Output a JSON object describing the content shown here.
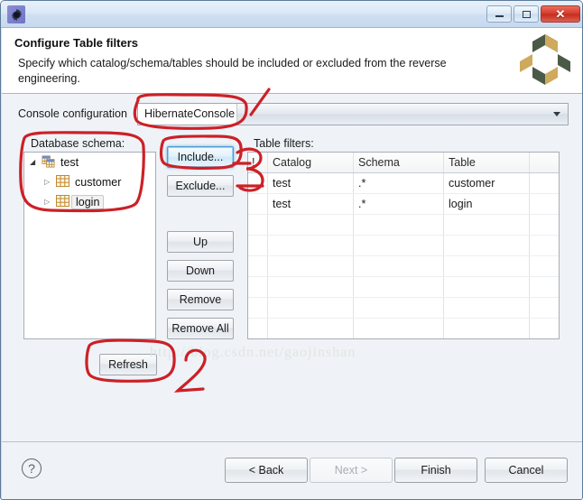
{
  "window": {
    "app_icon": "gear-icon",
    "minimize_label": "Minimize",
    "maximize_label": "Maximize",
    "close_label": "Close"
  },
  "header": {
    "title": "Configure Table filters",
    "description": "Specify which catalog/schema/tables should be included or excluded from the reverse engineering.",
    "logo": "hibernate-logo"
  },
  "console": {
    "label": "Console configuration",
    "value": "HibernateConsole",
    "dropdown_icon": "chevron-down-icon"
  },
  "schema": {
    "label": "Database schema:",
    "tree": [
      {
        "label": "test",
        "level": 0,
        "icon": "database-schema-icon",
        "expanded": true,
        "twisty": "◢",
        "selected": false
      },
      {
        "label": "customer",
        "level": 1,
        "icon": "table-icon",
        "expanded": false,
        "twisty": "▷",
        "selected": false
      },
      {
        "label": "login",
        "level": 1,
        "icon": "table-icon",
        "expanded": false,
        "twisty": "▷",
        "selected": true
      }
    ]
  },
  "actions": {
    "include": "Include...",
    "exclude": "Exclude...",
    "up": "Up",
    "down": "Down",
    "remove": "Remove",
    "remove_all": "Remove All",
    "refresh": "Refresh"
  },
  "filters": {
    "label": "Table filters:",
    "columns": [
      "!",
      "Catalog",
      "Schema",
      "Table",
      ""
    ],
    "rows": [
      [
        "",
        "test",
        ".*",
        "customer",
        ""
      ],
      [
        "",
        "test",
        ".*",
        "login",
        ""
      ]
    ],
    "empty_rows": 7
  },
  "watermark": "http://blog.csdn.net/gaojinshan",
  "footer": {
    "help_icon": "help-icon",
    "back": "< Back",
    "next": "Next >",
    "finish": "Finish",
    "cancel": "Cancel",
    "next_disabled": true
  },
  "annotations": {
    "color": "#cc2027",
    "marks": [
      "1",
      "2",
      "3"
    ]
  }
}
